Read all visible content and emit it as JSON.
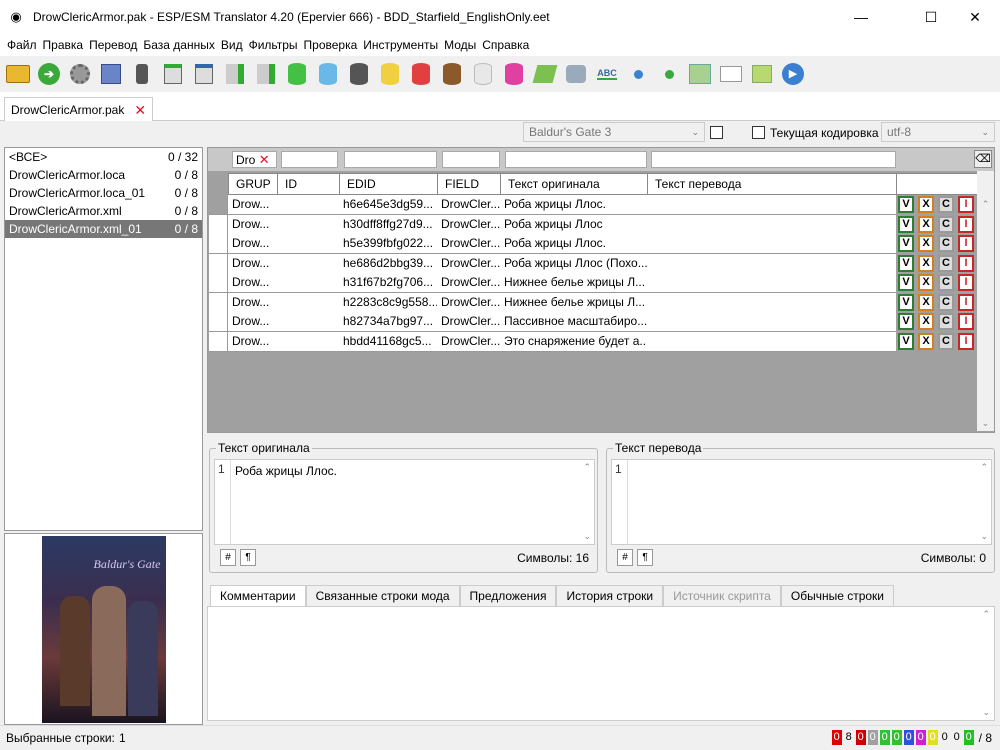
{
  "window": {
    "title": "DrowClericArmor.pak - ESP/ESM Translator 4.20 (Epervier 666) - BDD_Starfield_EnglishOnly.eet",
    "icon": "shield-icon",
    "minimize": "—",
    "maximize": "☐",
    "close": "✕"
  },
  "menu": [
    "Файл",
    "Правка",
    "Перевод",
    "База данных",
    "Вид",
    "Фильтры",
    "Проверка",
    "Инструменты",
    "Моды",
    "Справка"
  ],
  "doc_tab": {
    "label": "DrowClericArmor.pak",
    "close": "✕"
  },
  "selectors": {
    "game": "Baldur's Gate 3",
    "encoding_label": "Текущая кодировка",
    "encoding": "utf-8"
  },
  "files": [
    {
      "name": "<ВСЕ>",
      "count": "0 / 32"
    },
    {
      "name": "DrowClericArmor.loca",
      "count": "0 / 8"
    },
    {
      "name": "DrowClericArmor.loca_01",
      "count": "0 / 8"
    },
    {
      "name": "DrowClericArmor.xml",
      "count": "0 / 8"
    },
    {
      "name": "DrowClericArmor.xml_01",
      "count": "0 / 8"
    }
  ],
  "filter": {
    "grup": "Dro",
    "clear_icon": "✕"
  },
  "columns": [
    "GRUP",
    "ID",
    "EDID",
    "FIELD",
    "Текст оригинала",
    "Текст перевода"
  ],
  "rows": [
    {
      "grup": "Drow...",
      "id": "",
      "edid": "h6e645e3dg59...",
      "field": "DrowCler...",
      "orig": "Роба жрицы Ллос.",
      "trans": ""
    },
    {
      "grup": "Drow...",
      "id": "",
      "edid": "h30dff8ffg27d9...",
      "field": "DrowCler...",
      "orig": "Роба жрицы Ллос",
      "trans": ""
    },
    {
      "grup": "Drow...",
      "id": "",
      "edid": "h5e399fbfg022...",
      "field": "DrowCler...",
      "orig": "Роба жрицы Ллос.",
      "trans": ""
    },
    {
      "grup": "Drow...",
      "id": "",
      "edid": "he686d2bbg39...",
      "field": "DrowCler...",
      "orig": "Роба жрицы Ллос (Похо...",
      "trans": ""
    },
    {
      "grup": "Drow...",
      "id": "",
      "edid": "h31f67b2fg706...",
      "field": "DrowCler...",
      "orig": "Нижнее белье жрицы Л...",
      "trans": ""
    },
    {
      "grup": "Drow...",
      "id": "",
      "edid": "h2283c8c9g558...",
      "field": "DrowCler...",
      "orig": "Нижнее белье жрицы Л...",
      "trans": ""
    },
    {
      "grup": "Drow...",
      "id": "",
      "edid": "h82734a7bg97...",
      "field": "DrowCler...",
      "orig": "Пассивное масштабиро...",
      "trans": ""
    },
    {
      "grup": "Drow...",
      "id": "",
      "edid": "hbdd41168gc5...",
      "field": "DrowCler...",
      "orig": "Это снаряжение будет а...",
      "trans": ""
    }
  ],
  "row_actions": [
    "V",
    "X",
    "C",
    "I"
  ],
  "orig_panel": {
    "legend": "Текст оригинала",
    "line": "1",
    "text": "Роба жрицы Ллос.",
    "btn1": "#",
    "btn2": "¶",
    "chars": "Символы: 16"
  },
  "trans_panel": {
    "legend": "Текст перевода",
    "line": "1",
    "text": "",
    "btn1": "#",
    "btn2": "¶",
    "chars": "Символы: 0"
  },
  "bottom_tabs": [
    "Комментарии",
    "Связанные строки мода",
    "Предложения",
    "История строки",
    "Источник скрипта",
    "Обычные строки"
  ],
  "poster_text": "Baldur's Gate",
  "status": {
    "selected_label": "Выбранные строки:",
    "selected_count": "1",
    "counters": [
      "0",
      "8",
      "0",
      "0",
      "0",
      "0",
      "0",
      "0",
      "0",
      "0",
      "0",
      "0"
    ],
    "counter_colors": [
      "#e00000",
      "#f0f0f0",
      "#d00000",
      "#a0a0a0",
      "#30c030",
      "#30c030",
      "#3050e0",
      "#d020d0",
      "#e0e020",
      "#f0f0f0",
      "#f0f0f0",
      "#20c020"
    ],
    "total": "/ 8"
  }
}
